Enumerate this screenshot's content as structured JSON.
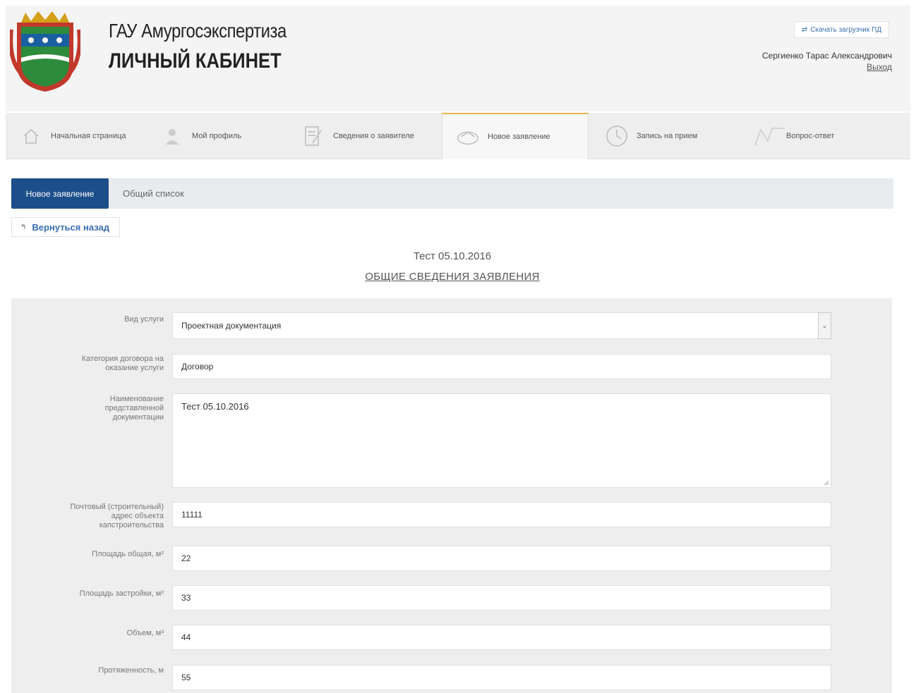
{
  "header": {
    "org_name": "ГАУ Амургосэкспертиза",
    "cabinet_title": "ЛИЧНЫЙ КАБИНЕТ",
    "download_label": "Скачать загрузчик ПД",
    "user_name": "Сергиенко Тарас Александрович",
    "logout_label": "Выход"
  },
  "nav": {
    "items": [
      {
        "label": "Начальная страница",
        "icon": "home-icon"
      },
      {
        "label": "Мой профиль",
        "icon": "user-icon"
      },
      {
        "label": "Сведения о заявителе",
        "icon": "edit-document-icon"
      },
      {
        "label": "Новое заявление",
        "icon": "envelope-icon"
      },
      {
        "label": "Запись на прием",
        "icon": "clock-icon"
      },
      {
        "label": "Вопрос-ответ",
        "icon": "chat-icon"
      }
    ],
    "active_index": 3
  },
  "subtabs": {
    "new_label": "Новое заявление",
    "list_label": "Общий список"
  },
  "back_label": "Вернуться назад",
  "application": {
    "title": "Тест 05.10.2016",
    "section_title": "ОБЩИЕ СВЕДЕНИЯ ЗАЯВЛЕНИЯ"
  },
  "form": {
    "service_type": {
      "label": "Вид услуги",
      "value": "Проектная документация"
    },
    "contract_category": {
      "label": "Категория договора на оказание услуги",
      "value": "Договор"
    },
    "doc_name": {
      "label": "Наименование представленной документации",
      "value": "Тест 05.10.2016"
    },
    "address": {
      "label": "Почтовый (строительный) адрес объекта капстроительства",
      "value": "11111"
    },
    "area_total": {
      "label": "Площадь общая, м²",
      "value": "22"
    },
    "area_built": {
      "label": "Площадь застройки, м²",
      "value": "33"
    },
    "volume": {
      "label": "Объем, м³",
      "value": "44"
    },
    "length": {
      "label": "Протяженность, м",
      "value": "55"
    }
  }
}
